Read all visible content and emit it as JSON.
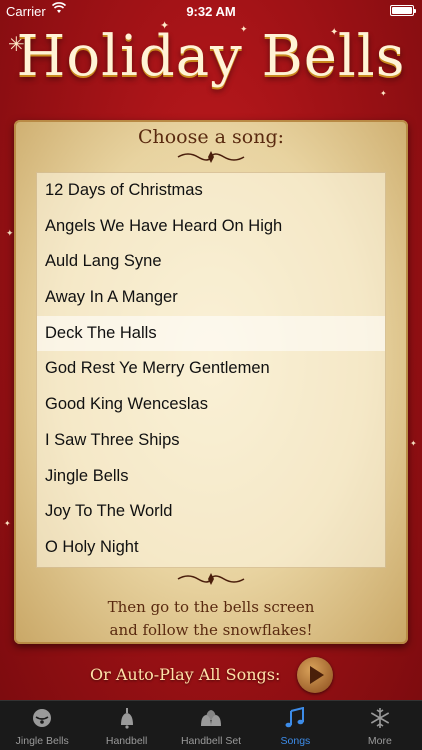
{
  "status_bar": {
    "carrier": "Carrier",
    "time": "9:32 AM"
  },
  "app_title": "Holiday Bells",
  "song_picker": {
    "header": "Choose a song:",
    "songs": [
      "12 Days of Christmas",
      "Angels We Have Heard On High",
      "Auld Lang Syne",
      "Away In A Manger",
      "Deck The Halls",
      "God Rest Ye Merry Gentlemen",
      "Good King Wenceslas",
      "I Saw Three Ships",
      "Jingle Bells",
      "Joy To The World",
      "O Holy Night"
    ],
    "selected_song": "Deck The Halls",
    "footer_line1": "Then go to the bells screen",
    "footer_line2": "and follow the snowflakes!"
  },
  "autoplay": {
    "label": "Or Auto-Play All Songs:",
    "icon": "play-icon"
  },
  "tab_bar": {
    "tabs": [
      {
        "label": "Jingle Bells",
        "icon": "jingle-bell-icon"
      },
      {
        "label": "Handbell",
        "icon": "handbell-icon"
      },
      {
        "label": "Handbell Set",
        "icon": "handbell-set-icon"
      },
      {
        "label": "Songs",
        "icon": "music-notes-icon"
      },
      {
        "label": "More",
        "icon": "snowflake-icon"
      }
    ],
    "active_tab": "Songs"
  },
  "colors": {
    "background_red": "#a01216",
    "parchment": "#e8d3a0",
    "title_gold": "#c98a1e",
    "active_tab_blue": "#3d8ce8"
  }
}
